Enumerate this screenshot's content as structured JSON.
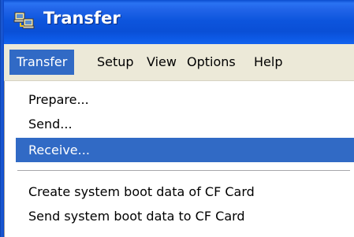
{
  "window": {
    "title": "Transfer",
    "icon": "transfer-icon"
  },
  "menubar": {
    "items": [
      {
        "label": "Transfer",
        "active": true
      },
      {
        "label": "Setup"
      },
      {
        "label": "View"
      },
      {
        "label": "Options"
      },
      {
        "label": "Help"
      }
    ]
  },
  "dropdown": {
    "items": [
      {
        "label": "Prepare..."
      },
      {
        "label": "Send..."
      },
      {
        "label": "Receive...",
        "selected": true
      },
      {
        "label": "Create system boot data of CF Card"
      },
      {
        "label": "Send system boot data to CF Card"
      }
    ]
  },
  "colors": {
    "titlebar": "#0a4fd6",
    "menu_highlight": "#316ac5",
    "menubar_bg": "#ece9d8"
  }
}
